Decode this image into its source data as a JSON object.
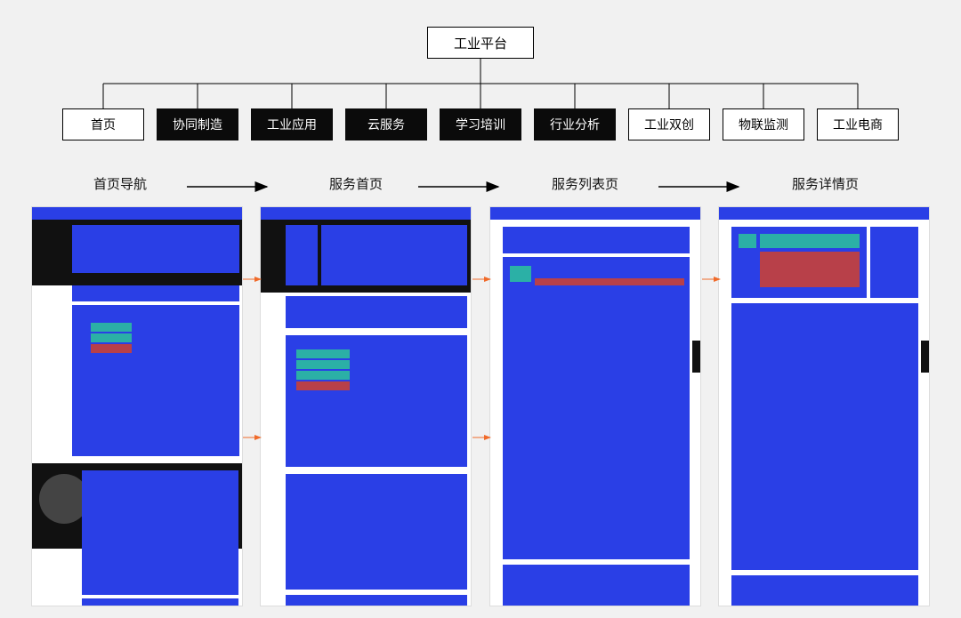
{
  "root": {
    "title": "工业平台"
  },
  "nav": {
    "items": [
      {
        "label": "首页",
        "dark": false
      },
      {
        "label": "协同制造",
        "dark": true
      },
      {
        "label": "工业应用",
        "dark": true
      },
      {
        "label": "云服务",
        "dark": true
      },
      {
        "label": "学习培训",
        "dark": true
      },
      {
        "label": "行业分析",
        "dark": true
      },
      {
        "label": "工业双创",
        "dark": false
      },
      {
        "label": "物联监测",
        "dark": false
      },
      {
        "label": "工业电商",
        "dark": false
      }
    ]
  },
  "flow": {
    "steps": [
      {
        "label": "首页导航"
      },
      {
        "label": "服务首页"
      },
      {
        "label": "服务列表页"
      },
      {
        "label": "服务详情页"
      }
    ]
  },
  "colors": {
    "primary": "#2a3fe6",
    "teal": "#2bb0a6",
    "red": "#b84049",
    "dark": "#111111"
  }
}
